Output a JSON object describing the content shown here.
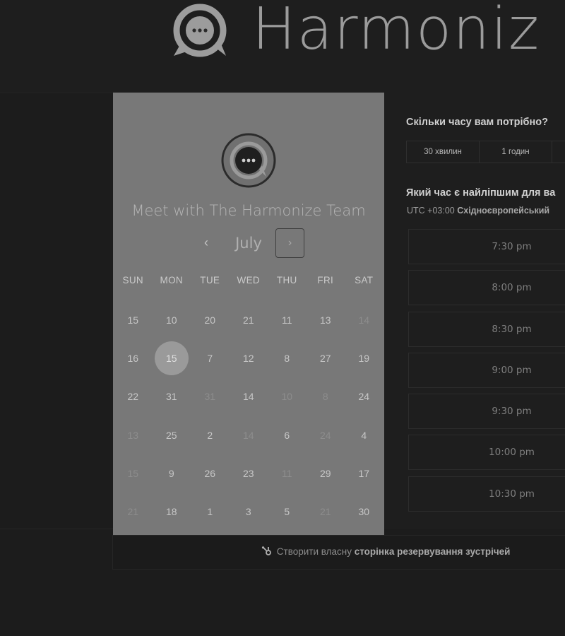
{
  "header": {
    "brand_name": "Harmoniz",
    "logo_icon": "chat-bubble-logo-icon"
  },
  "calendar": {
    "meeting_title": "Meet with The Harmonize Team",
    "avatar_icon": "chat-bubble-avatar-icon",
    "month": "July",
    "prev_icon": "‹",
    "next_icon": "›",
    "weekdays": [
      "SUN",
      "MON",
      "TUE",
      "WED",
      "THU",
      "FRI",
      "SAT"
    ],
    "days": [
      {
        "label": "15",
        "disabled": false
      },
      {
        "label": "10",
        "disabled": false
      },
      {
        "label": "20",
        "disabled": false
      },
      {
        "label": "21",
        "disabled": false
      },
      {
        "label": "11",
        "disabled": false
      },
      {
        "label": "13",
        "disabled": false
      },
      {
        "label": "14",
        "disabled": true
      },
      {
        "label": "16",
        "disabled": false
      },
      {
        "label": "15",
        "disabled": false,
        "selected": true
      },
      {
        "label": "7",
        "disabled": false
      },
      {
        "label": "12",
        "disabled": false
      },
      {
        "label": "8",
        "disabled": false
      },
      {
        "label": "27",
        "disabled": false
      },
      {
        "label": "19",
        "disabled": false
      },
      {
        "label": "22",
        "disabled": false
      },
      {
        "label": "31",
        "disabled": false
      },
      {
        "label": "31",
        "disabled": true
      },
      {
        "label": "14",
        "disabled": false
      },
      {
        "label": "10",
        "disabled": true
      },
      {
        "label": "8",
        "disabled": true
      },
      {
        "label": "24",
        "disabled": false
      },
      {
        "label": "13",
        "disabled": true
      },
      {
        "label": "25",
        "disabled": false
      },
      {
        "label": "2",
        "disabled": false
      },
      {
        "label": "14",
        "disabled": true
      },
      {
        "label": "6",
        "disabled": false
      },
      {
        "label": "24",
        "disabled": true
      },
      {
        "label": "4",
        "disabled": false
      },
      {
        "label": "15",
        "disabled": true
      },
      {
        "label": "9",
        "disabled": false
      },
      {
        "label": "26",
        "disabled": false
      },
      {
        "label": "23",
        "disabled": false
      },
      {
        "label": "11",
        "disabled": true
      },
      {
        "label": "29",
        "disabled": false
      },
      {
        "label": "17",
        "disabled": false
      },
      {
        "label": "21",
        "disabled": true
      },
      {
        "label": "18",
        "disabled": false
      },
      {
        "label": "1",
        "disabled": false
      },
      {
        "label": "3",
        "disabled": false
      },
      {
        "label": "5",
        "disabled": false
      },
      {
        "label": "21",
        "disabled": true
      },
      {
        "label": "30",
        "disabled": false
      }
    ]
  },
  "booking": {
    "duration_question": "Скільки часу вам потрібно?",
    "durations": [
      "30 хвилин",
      "1 годин"
    ],
    "time_question": "Який час є найліпшим для ва",
    "timezone_offset": "UTC +03:00",
    "timezone_name": "Східноєвропейський",
    "slots": [
      "7:30 pm",
      "8:00 pm",
      "8:30 pm",
      "9:00 pm",
      "9:30 pm",
      "10:00 pm",
      "10:30 pm"
    ]
  },
  "footer": {
    "icon": "hubspot-sprocket-icon",
    "text_prefix": "Створити власну",
    "text_link": "сторінка резервування зустрічей"
  }
}
